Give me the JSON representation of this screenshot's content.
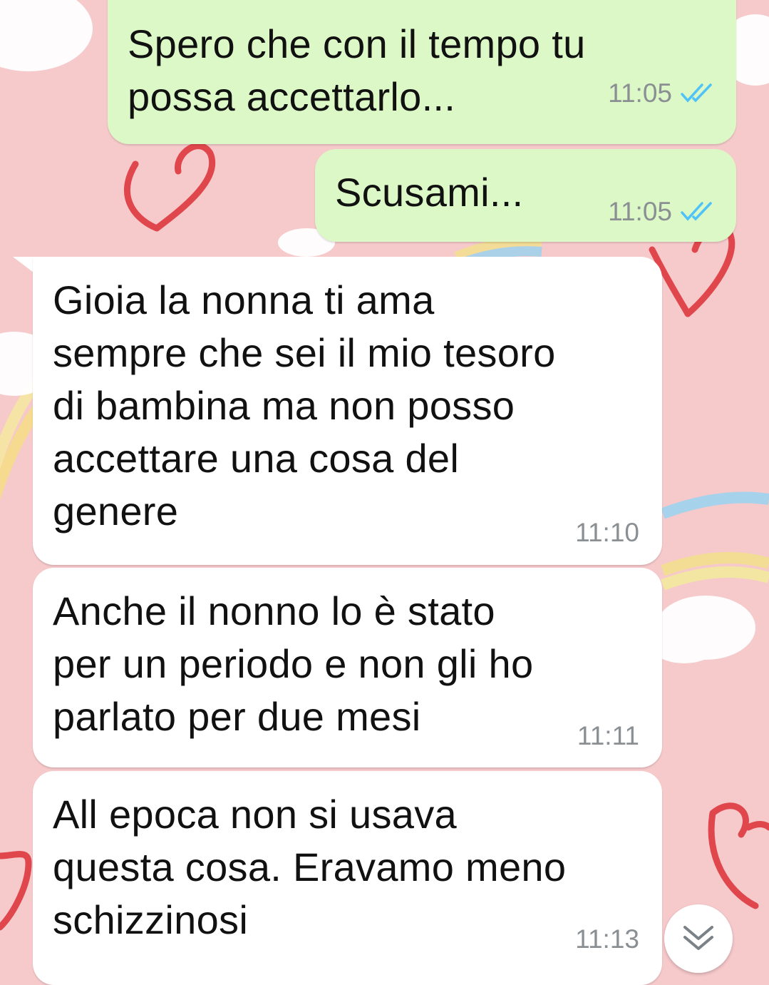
{
  "colors": {
    "outgoing_bubble": "#dcf8c6",
    "incoming_bubble": "#ffffff",
    "wallpaper": "#f6c9cb",
    "read_ticks": "#4fc3f7",
    "timestamp": "#8a8f93"
  },
  "messages": [
    {
      "direction": "outgoing",
      "text": "Spero che con il tempo tu\npossa accettarlo...",
      "time": "11:05",
      "status": "read",
      "status_icon": "double-check-read-icon"
    },
    {
      "direction": "outgoing",
      "text": "Scusami...",
      "time": "11:05",
      "status": "read",
      "status_icon": "double-check-read-icon"
    },
    {
      "direction": "incoming",
      "text": "Gioia la nonna ti ama\nsempre che sei il mio tesoro\ndi bambina ma non posso\naccettare una cosa del\ngenere",
      "time": "11:10"
    },
    {
      "direction": "incoming",
      "text": "Anche il nonno lo è stato\nper un periodo e non gli ho\nparlato per due mesi",
      "time": "11:11"
    },
    {
      "direction": "incoming",
      "text": "All epoca non si usava\nquesta cosa. Eravamo meno\nschizzinosi",
      "time": "11:13"
    }
  ],
  "scroll_button": {
    "icon": "double-chevron-down-icon"
  }
}
